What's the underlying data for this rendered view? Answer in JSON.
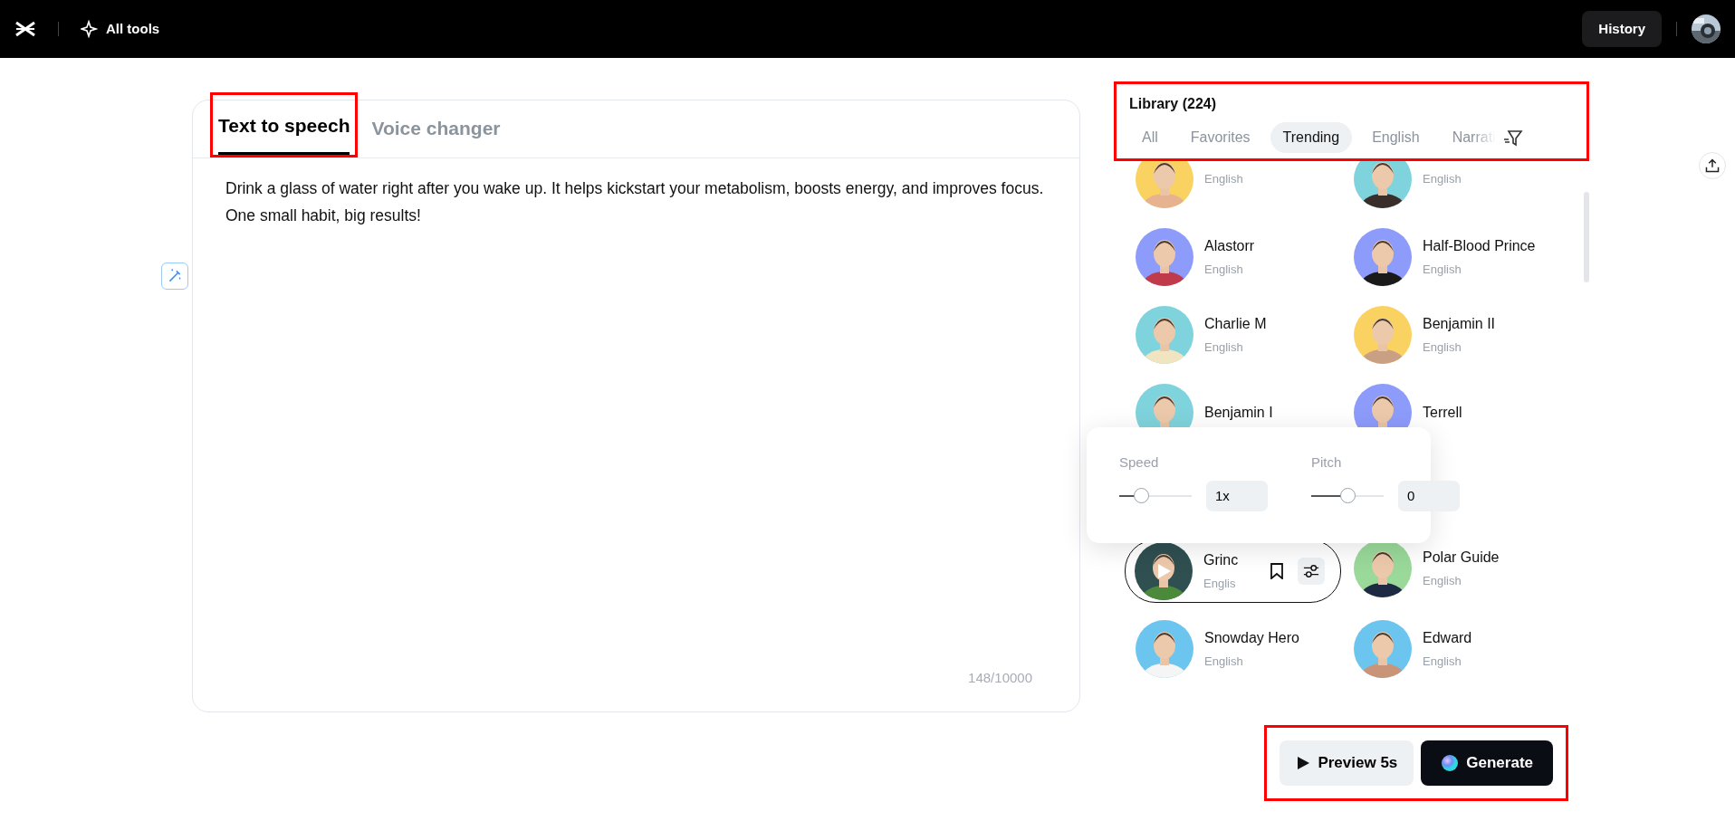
{
  "topbar": {
    "tools_label": "All tools",
    "history_button": "History"
  },
  "editor": {
    "tabs": [
      {
        "label": "Text to speech",
        "selected": true,
        "highlighted": true
      },
      {
        "label": "Voice changer",
        "selected": false,
        "highlighted": false
      }
    ],
    "text": "Drink a glass of water right after you wake up. It helps kickstart your metabolism, boosts energy, and improves focus. One small habit, big results!",
    "counter": "148/10000"
  },
  "library": {
    "title": "Library (224)",
    "highlighted": true,
    "filters": [
      {
        "label": "All",
        "selected": false
      },
      {
        "label": "Favorites",
        "selected": false
      },
      {
        "label": "Trending",
        "selected": true
      },
      {
        "label": "English",
        "selected": false
      },
      {
        "label": "Narrati",
        "selected": false
      }
    ],
    "voices": [
      {
        "language": "English",
        "hovered": false,
        "faded": false
      },
      {
        "language": "English",
        "hovered": false,
        "faded": false
      },
      {
        "name": "Alastorr",
        "language": "English",
        "hovered": false,
        "faded": false
      },
      {
        "name": "Half-Blood Prince",
        "language": "English",
        "hovered": false,
        "faded": false
      },
      {
        "name": "Charlie M",
        "language": "English",
        "hovered": false,
        "faded": false
      },
      {
        "name": "Benjamin II",
        "language": "English",
        "hovered": false,
        "faded": false
      },
      {
        "name": "Benjamin I",
        "hovered": false,
        "faded": false
      },
      {
        "name": "Terrell",
        "hovered": false,
        "faded": false
      },
      {
        "name": "Grinc",
        "language": "Englis",
        "hovered": true,
        "faded": false
      },
      {
        "name": "Polar Guide",
        "language": "English",
        "hovered": false,
        "faded": false
      },
      {
        "name": "Snowday Hero",
        "language": "English",
        "hovered": false,
        "faded": false
      },
      {
        "name": "Edward",
        "language": "English",
        "hovered": false,
        "faded": false
      }
    ]
  },
  "adjust_popup": {
    "speed": {
      "label": "Speed",
      "level": 0.3,
      "value": "1x"
    },
    "pitch": {
      "label": "Pitch",
      "level": 0.5,
      "value": "0"
    }
  },
  "actions": {
    "highlighted": true,
    "preview": "Preview 5s",
    "generate": "Generate"
  }
}
